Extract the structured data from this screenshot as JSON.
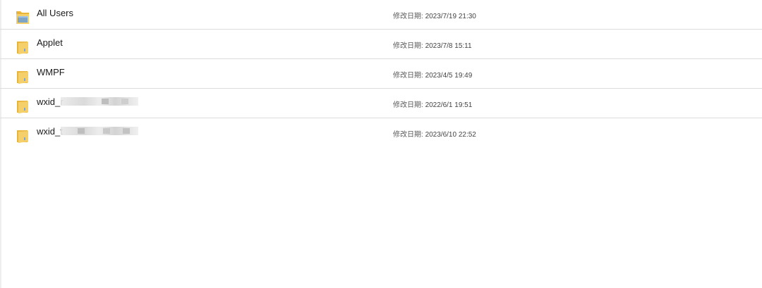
{
  "files": [
    {
      "name": "All Users",
      "date_label": "修改日期:",
      "date": "2023/7/19 21:30",
      "icon": "folder-shortcut-icon",
      "obscured": false
    },
    {
      "name": "Applet",
      "date_label": "修改日期:",
      "date": "2023/7/8 15:11",
      "icon": "folder-icon",
      "obscured": false
    },
    {
      "name": "WMPF",
      "date_label": "修改日期:",
      "date": "2023/4/5 19:49",
      "icon": "folder-icon",
      "obscured": false
    },
    {
      "name": "wxid_r",
      "date_label": "修改日期:",
      "date": "2022/6/1 19:51",
      "icon": "folder-icon",
      "obscured": true
    },
    {
      "name": "wxid_t",
      "date_label": "修改日期:",
      "date": "2023/6/10 22:52",
      "icon": "folder-icon",
      "obscured": true
    }
  ],
  "colors": {
    "folder_front": "#f5cf6a",
    "folder_back": "#e8b53a",
    "shortcut_blue": "#6a9ed6",
    "divider": "#dcdcdc"
  }
}
